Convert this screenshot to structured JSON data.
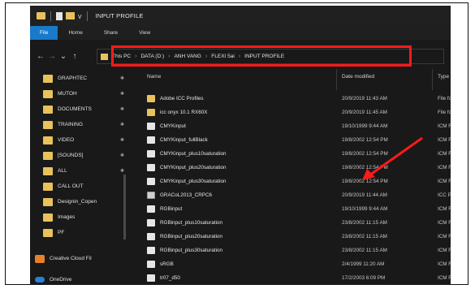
{
  "titlebar": {
    "title": "INPUT PROFILE",
    "arrow": "v"
  },
  "ribbon": {
    "tabs": [
      "File",
      "Home",
      "Share",
      "View"
    ]
  },
  "nav": {
    "back": "←",
    "forward": "→",
    "dropdown": "⌄",
    "up": "↑"
  },
  "address": {
    "crumbs": [
      "This PC",
      "DATA (D:)",
      "ANH VANG",
      "FLEXI 5ai",
      "INPUT PROFILE"
    ],
    "separator": "›"
  },
  "sidebar": {
    "items": [
      {
        "label": "GRAPHTEC",
        "pinned": true
      },
      {
        "label": "MUTOH",
        "pinned": true
      },
      {
        "label": "DOCUMENTS",
        "pinned": true
      },
      {
        "label": "TRAINING",
        "pinned": true
      },
      {
        "label": "VIDEO",
        "pinned": true
      },
      {
        "label": "[SOUNDS]",
        "pinned": true
      },
      {
        "label": "ALL",
        "pinned": true
      },
      {
        "label": "CALL OUT",
        "pinned": false
      },
      {
        "label": "Designin_Copen",
        "pinned": false
      },
      {
        "label": "Images",
        "pinned": false
      },
      {
        "label": "PF",
        "pinned": false
      }
    ],
    "creative_cloud": "Creative Cloud Fil",
    "onedrive": "OneDrive",
    "pin_glyph": "✱"
  },
  "columns": {
    "name": "Name",
    "date": "Date modified",
    "type": "Type"
  },
  "files": [
    {
      "name": "Adobe ICC Profiles",
      "date": "20/9/2019 11:43 AM",
      "type": "File folder",
      "kind": "folder"
    },
    {
      "name": "icc onyx 10.1 RX60X",
      "date": "20/9/2019 11:45 AM",
      "type": "File folder",
      "kind": "folder"
    },
    {
      "name": "CMYKinput",
      "date": "19/10/1999 9:44 AM",
      "type": "ICM File",
      "kind": "icm"
    },
    {
      "name": "CMYKinput_fullBlack",
      "date": "19/8/2002 12:54 PM",
      "type": "ICM File",
      "kind": "icm"
    },
    {
      "name": "CMYKinput_plus10saturation",
      "date": "19/8/2002 12:54 PM",
      "type": "ICM File",
      "kind": "icm"
    },
    {
      "name": "CMYKinput_plus20saturation",
      "date": "19/8/2002 12:54 PM",
      "type": "ICM File",
      "kind": "icm"
    },
    {
      "name": "CMYKinput_plus30saturation",
      "date": "19/8/2002 12:54 PM",
      "type": "ICM File",
      "kind": "icm"
    },
    {
      "name": "GRACoL2013_CRPC6",
      "date": "20/9/2019 11:44 AM",
      "type": "ICC Profile",
      "kind": "icc"
    },
    {
      "name": "RGBinput",
      "date": "19/10/1999 9:44 AM",
      "type": "ICM File",
      "kind": "icm"
    },
    {
      "name": "RGBinput_plus10saturation",
      "date": "23/8/2002 11:15 AM",
      "type": "ICM File",
      "kind": "icm"
    },
    {
      "name": "RGBinput_plus20saturation",
      "date": "23/8/2002 11:15 AM",
      "type": "ICM File",
      "kind": "icm"
    },
    {
      "name": "RGBinput_plus30saturation",
      "date": "23/8/2002 11:15 AM",
      "type": "ICM File",
      "kind": "icm"
    },
    {
      "name": "sRGB",
      "date": "2/4/1999 11:20 AM",
      "type": "ICM File",
      "kind": "icm"
    },
    {
      "name": "tr07_d50",
      "date": "17/2/2003 6:09 PM",
      "type": "ICM File",
      "kind": "icm"
    }
  ],
  "colors": {
    "background": "#191919",
    "folder": "#e8c25a",
    "file_tab": "#1979ca",
    "highlight": "#ff1a1a",
    "arrow": "#ff1a1a"
  },
  "icons": {
    "folder": "folder-icon",
    "icm": "icm-file-icon",
    "icc": "icc-profile-icon",
    "creative_cloud": "creative-cloud-icon",
    "onedrive": "onedrive-icon"
  }
}
